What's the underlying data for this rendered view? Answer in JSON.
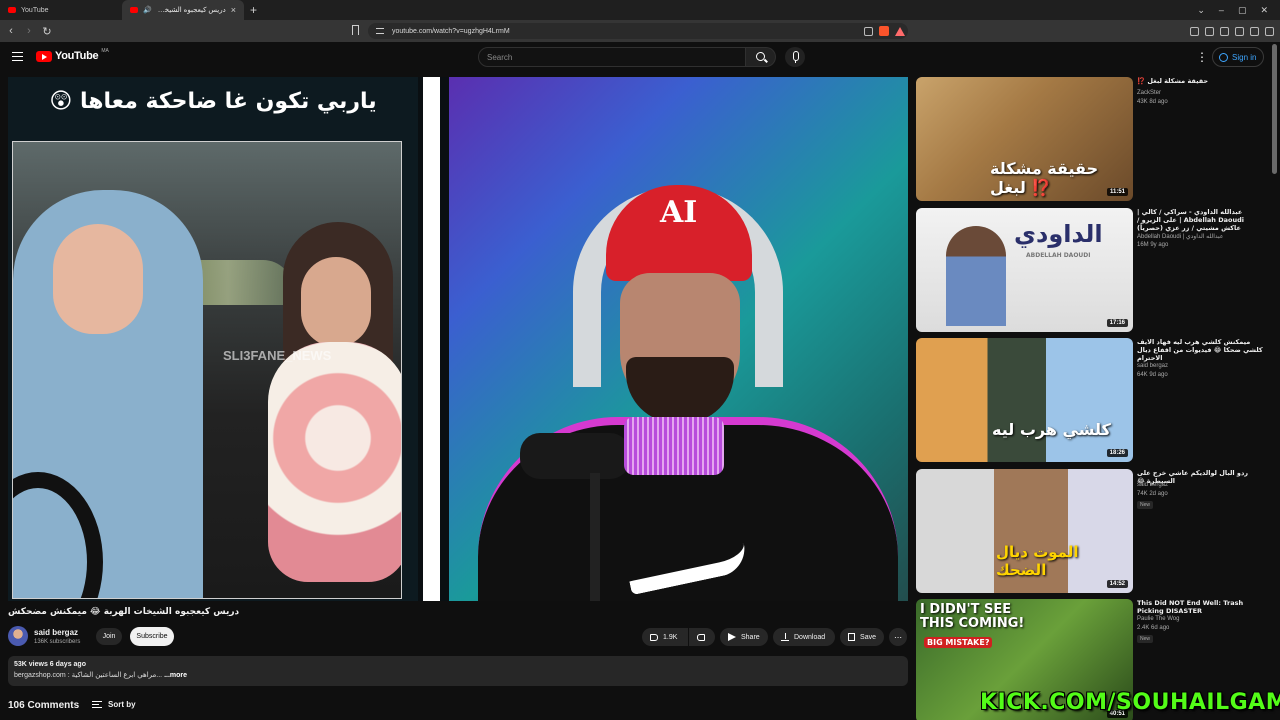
{
  "browser": {
    "tabs": [
      {
        "label": "YouTube",
        "active": false
      },
      {
        "label": "دريس كيعجبوه الشيخات الهربة 😂 ميمكنش مضحكش - YouTube",
        "active": true
      }
    ],
    "url": "youtube.com/watch?v=ugzhgH4LrmM"
  },
  "header": {
    "logo_text": "YouTube",
    "logo_superscript": "MA",
    "search_placeholder": "Search",
    "sign_in_label": "Sign in"
  },
  "player": {
    "caption": "ياربي تكون غا ضاحكة معاها 😲",
    "watermark": "SLI3FANE_NEWS",
    "cap_logo": "AI"
  },
  "video": {
    "title": "دريس كيعجبوه الشيخات الهربة 😂 ميمكنش مضحكش",
    "channel": {
      "name": "said bergaz",
      "subscribers": "136K subscribers"
    },
    "join_label": "Join",
    "subscribe_label": "Subscribe",
    "likes": "1.9K",
    "share_label": "Share",
    "download_label": "Download",
    "save_label": "Save",
    "views_date": "53K views  6 days ago",
    "description": "bergazshop.com : مراهي ابرع الساعتين الشاكية...",
    "more_label": "...more",
    "comments_count": "106 Comments",
    "sort_label": "Sort by"
  },
  "related": [
    {
      "title": "حقيقة مشكلة لبغل ⁉️",
      "channel": "ZackSter",
      "stats": "43K  8d ago",
      "duration": "11:51",
      "badge": ""
    },
    {
      "title": "عبدالله الداودي - سراكي / كالي | Abdellah Daoudi | على الزيرو / عاكش مشيتي / زر عزي (حصرياً)",
      "channel": "Abdellah Daoudi | عبدالله الداودي",
      "stats": "16M  9y ago",
      "duration": "17:16",
      "badge": ""
    },
    {
      "title": "ميمكنش كلشي هرب ليه فهاد الايف كلشي ضحكا 😂 فيديوات من اقفاع ديال الاحترام",
      "channel": "said bergaz",
      "stats": "64K  9d ago",
      "duration": "18:26",
      "badge": ""
    },
    {
      "title": "ردو البال لوالديكم عاشي خرج على السيطرة 😂",
      "channel": "said bergaz",
      "stats": "74K  2d ago",
      "duration": "14:52",
      "badge": "New"
    },
    {
      "title": "This Did NOT End Well: Trash Picking DISASTER",
      "channel": "Paulie The Wog",
      "stats": "2.4K  6d ago",
      "duration": "40:51",
      "badge": "New"
    }
  ],
  "thumb_texts": {
    "t1": "حقيقة مشكلة لبغل ⁉️",
    "t2": "الداودي",
    "t2_sub": "ABDELLAH DAOUDI",
    "t3": "كلشي هرب ليه",
    "t4": "الموت ديال الضحك",
    "t5": "I DIDN'T SEE THIS COMING!",
    "t5_sub": "BIG MISTAKE?"
  },
  "overlay": {
    "kick": "KICK.COM/SOUHAILGAMING"
  },
  "colors": {
    "accent": "#ff0000",
    "link": "#3ea6ff",
    "kick": "#53fc18"
  }
}
